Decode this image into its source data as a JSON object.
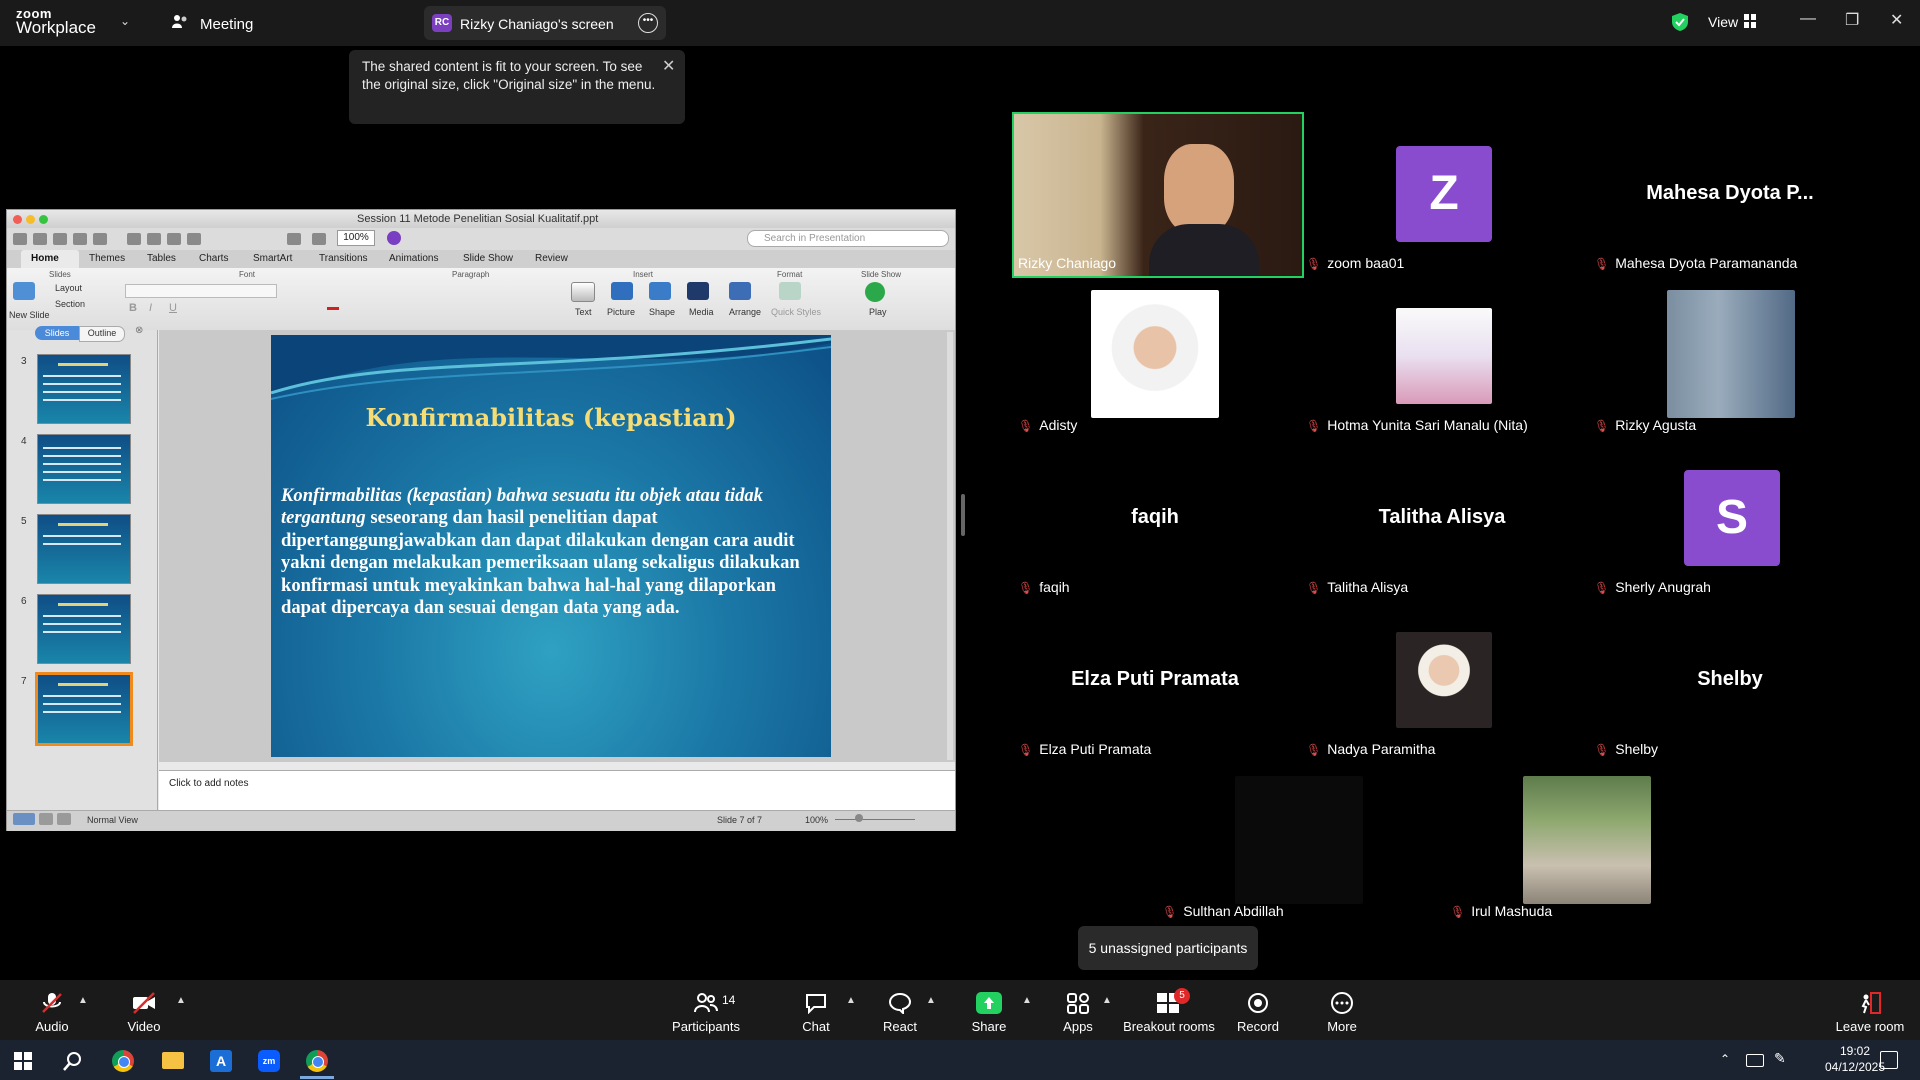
{
  "zoom_app": {
    "logo_line1": "zoom",
    "logo_line2": "Workplace",
    "meeting_label": "Meeting",
    "share_badge": "RC",
    "share_tab_label": "Rizky Chaniago's screen",
    "view_label": "View",
    "accent_green": "#23d160"
  },
  "tooltip": {
    "text": "The shared content is fit to your screen. To see the original size, click \"Original size\" in the menu."
  },
  "powerpoint": {
    "window_title": "Session 11 Metode Penelitian Sosial Kualitatif.ppt",
    "zoom": "100%",
    "search_placeholder": "Search in Presentation",
    "ribbon_tabs": [
      "Home",
      "Themes",
      "Tables",
      "Charts",
      "SmartArt",
      "Transitions",
      "Animations",
      "Slide Show",
      "Review"
    ],
    "groups": [
      "Slides",
      "Font",
      "Paragraph",
      "Insert",
      "Format",
      "Slide Show"
    ],
    "ribbon_labels": {
      "new_slide": "New Slide",
      "layout": "Layout",
      "section": "Section",
      "text": "Text",
      "picture": "Picture",
      "shape": "Shape",
      "media": "Media",
      "arrange": "Arrange",
      "quick_styles": "Quick Styles",
      "play": "Play"
    },
    "pane_tabs": {
      "slides": "Slides",
      "outline": "Outline"
    },
    "thumb_numbers": [
      "3",
      "4",
      "5",
      "6",
      "7"
    ],
    "slide": {
      "title": "Konfirmabilitas (kepastian)",
      "body_italic": "Konfirmabilitas (kepastian) bahwa sesuatu itu objek atau tidak tergantung",
      "body_rest": " seseorang dan hasil penelitian dapat dipertanggungjawabkan dan dapat dilakukan dengan cara audit yakni dengan melakukan pemeriksaan ulang sekaligus dilakukan konfirmasi untuk meyakinkan bahwa hal-hal yang dilaporkan dapat dipercaya dan sesuai dengan data yang ada."
    },
    "notes_placeholder": "Click to add notes",
    "status": {
      "view": "Normal View",
      "slide_of": "Slide 7 of 7",
      "zoom": "100%"
    }
  },
  "gallery": {
    "participants": [
      {
        "name": "Rizky Chaniago",
        "type": "video"
      },
      {
        "name": "zoom baa01",
        "type": "letter",
        "letter": "Z"
      },
      {
        "name": "Mahesa Dyota Paramananda",
        "type": "text",
        "display": "Mahesa Dyota P..."
      },
      {
        "name": "Adisty",
        "type": "photo"
      },
      {
        "name": "Hotma Yunita Sari Manalu (Nita)",
        "type": "photo"
      },
      {
        "name": "Rizky Agusta",
        "type": "photo"
      },
      {
        "name": "faqih",
        "type": "text",
        "display": "faqih"
      },
      {
        "name": "Talitha Alisya",
        "type": "text",
        "display": "Talitha Alisya"
      },
      {
        "name": "Sherly Anugrah",
        "type": "letter",
        "letter": "S"
      },
      {
        "name": "Elza Puti Pramata",
        "type": "text",
        "display": "Elza Puti Pramata"
      },
      {
        "name": "Nadya Paramitha",
        "type": "photo"
      },
      {
        "name": "Shelby",
        "type": "text",
        "display": "Shelby"
      },
      {
        "name": "Sulthan Abdillah",
        "type": "photo"
      },
      {
        "name": "Irul Mashuda",
        "type": "photo"
      }
    ],
    "unassigned": "5 unassigned participants"
  },
  "controls": {
    "audio": "Audio",
    "video": "Video",
    "participants_count": "14",
    "participants": "Participants",
    "chat": "Chat",
    "react": "React",
    "share": "Share",
    "apps": "Apps",
    "breakout_badge": "5",
    "breakout": "Breakout rooms",
    "record": "Record",
    "more": "More",
    "leave": "Leave room"
  },
  "taskbar": {
    "time": "19:02",
    "date": "04/12/2025"
  }
}
